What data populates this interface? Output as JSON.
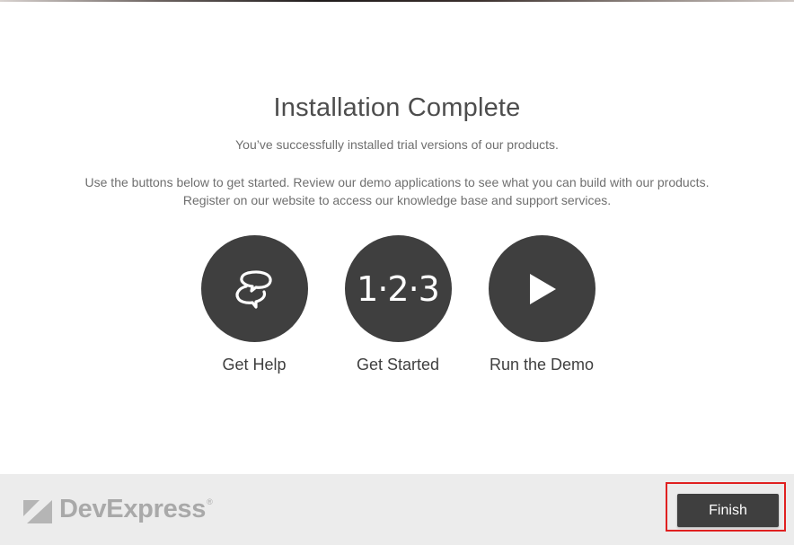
{
  "header": {
    "title": "Installation Complete",
    "subtitle": "You’ve successfully installed trial versions of our products.",
    "description_lines": [
      "Use the buttons below to get started. Review our demo applications to see what you can build with our products.",
      "Register on our website to access our knowledge base and support services."
    ]
  },
  "actions": [
    {
      "label": "Get Help",
      "icon": "chat-bubbles-icon"
    },
    {
      "label": "Get Started",
      "icon": "steps-123-icon",
      "icon_text": "1·2·3"
    },
    {
      "label": "Run the Demo",
      "icon": "play-icon"
    }
  ],
  "footer": {
    "brand": "DevExpress",
    "brand_mark": "®",
    "finish_label": "Finish"
  },
  "colors": {
    "accent_dark": "#3f3f3f",
    "footer_bg": "#ececec",
    "highlight": "#e02020"
  }
}
